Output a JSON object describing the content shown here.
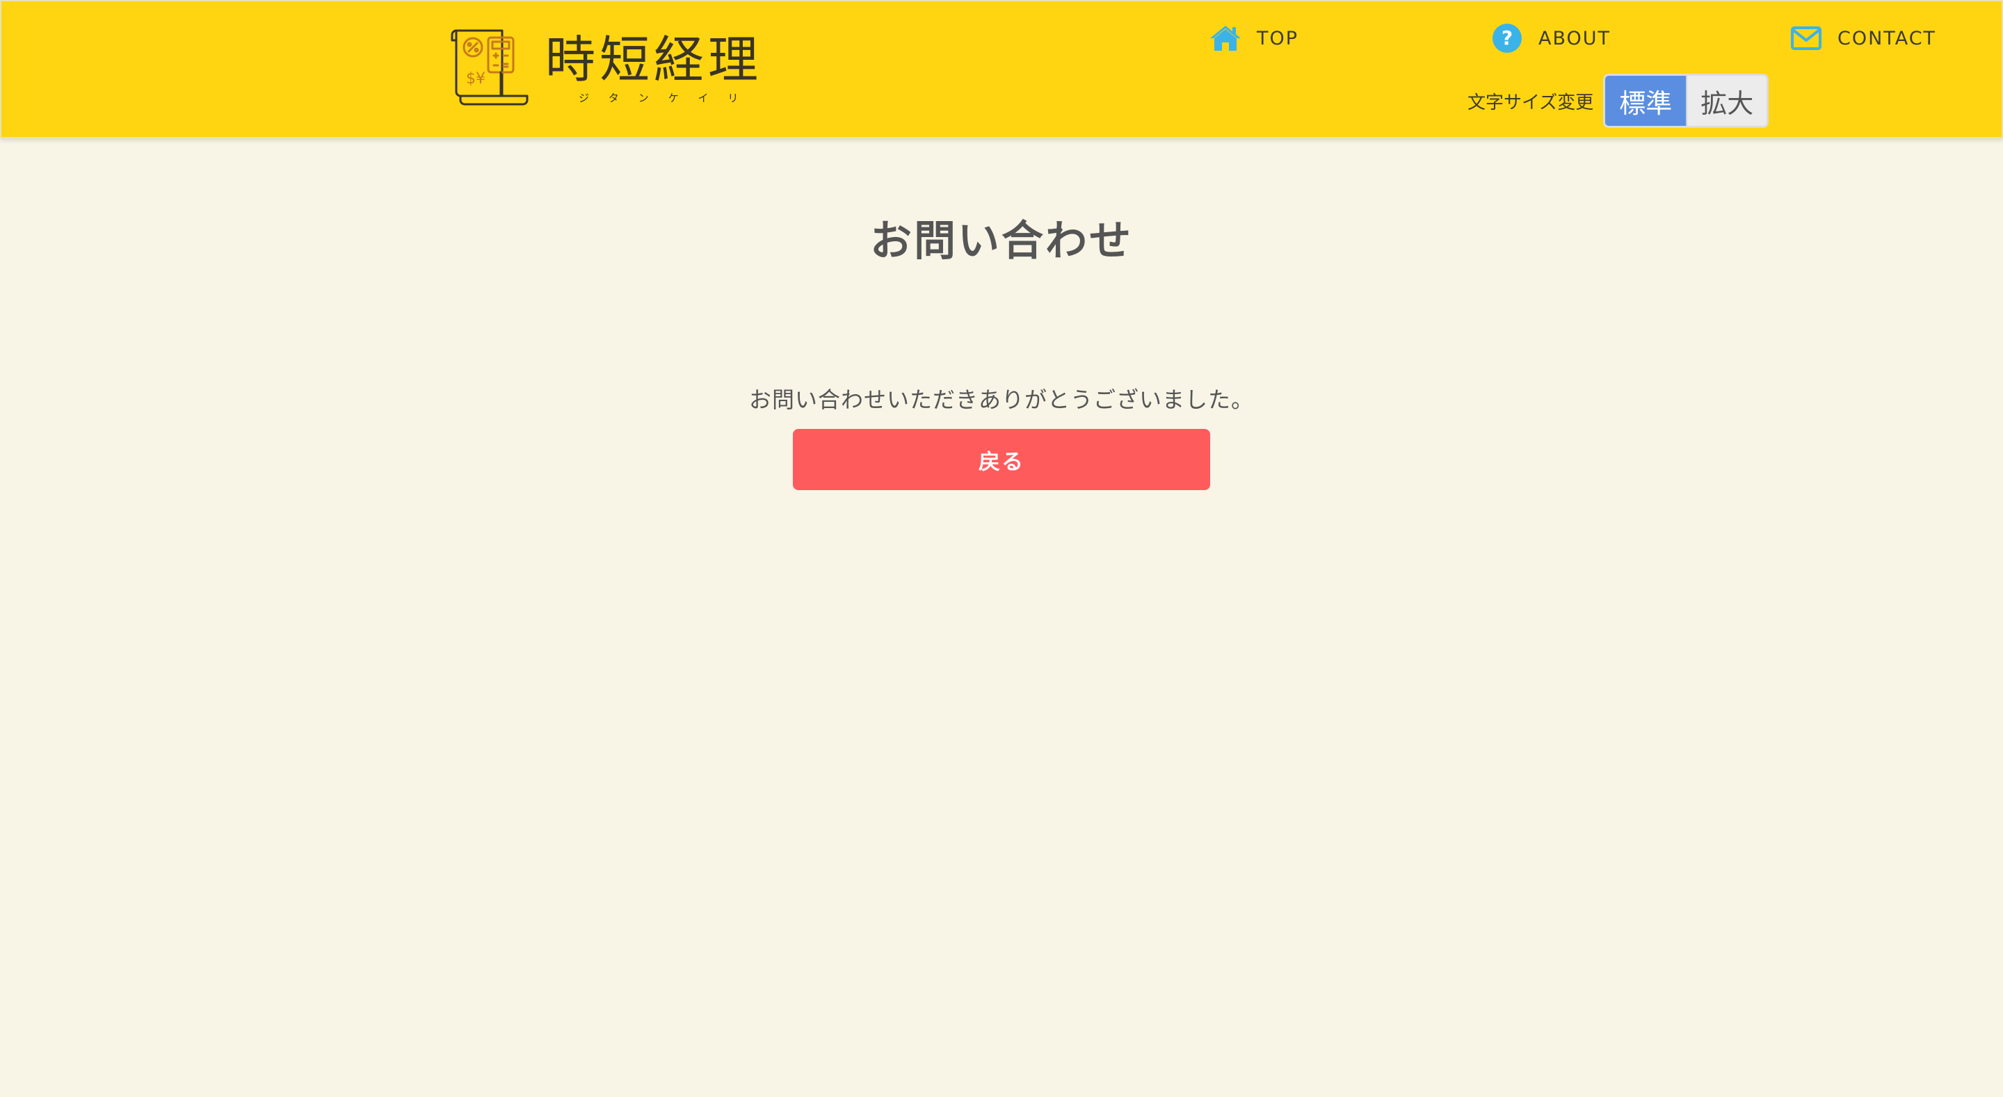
{
  "header": {
    "logo": {
      "title": "時短経理",
      "subtitle": "ジタンケイリ"
    },
    "nav": [
      {
        "label": "TOP",
        "icon": "home-icon"
      },
      {
        "label": "ABOUT",
        "icon": "question-circle-icon"
      },
      {
        "label": "CONTACT",
        "icon": "envelope-icon"
      }
    ],
    "font_size": {
      "label": "文字サイズ変更",
      "options": [
        {
          "label": "標準",
          "selected": true
        },
        {
          "label": "拡大",
          "selected": false
        }
      ]
    },
    "colors": {
      "background": "#fed510",
      "icon": "#3bb3e8",
      "active_button": "#5b8ee0"
    }
  },
  "main": {
    "title": "お問い合わせ",
    "message": "お問い合わせいただきありがとうございました。",
    "back_button": "戻る",
    "colors": {
      "page_background": "#f8f4e6",
      "button": "#fe5b5d"
    }
  }
}
